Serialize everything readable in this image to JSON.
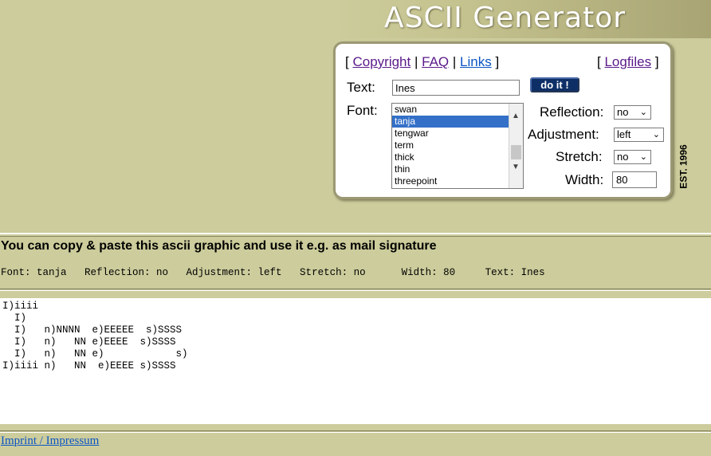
{
  "banner": {
    "title": "ASCII Generator",
    "est": "EST. 1996"
  },
  "links": {
    "copyright": "Copyright",
    "faq": "FAQ",
    "links": "Links",
    "logfiles": "Logfiles",
    "lbr": "[",
    "rbr": "]",
    "sep": "|"
  },
  "form": {
    "text_label": "Text:",
    "text_value": "Ines",
    "button": "do it !",
    "font_label": "Font:",
    "fonts": [
      "swan",
      "tanja",
      "tengwar",
      "term",
      "thick",
      "thin",
      "threepoint"
    ],
    "selected_font": "tanja",
    "reflection_label": "Reflection:",
    "reflection_value": "no",
    "adjustment_label": "Adjustment:",
    "adjustment_value": "left",
    "stretch_label": "Stretch:",
    "stretch_value": "no",
    "width_label": "Width:",
    "width_value": "80"
  },
  "result": {
    "hint": "You can copy & paste this ascii graphic and use it e.g. as mail signature",
    "params": "Font: tanja   Reflection: no   Adjustment: left   Stretch: no      Width: 80     Text: Ines",
    "ascii": "I)iiii\n  I)\n  I)   n)NNNN  e)EEEEE  s)SSSS\n  I)   n)   NN e)EEEE  s)SSSS\n  I)   n)   NN e)            s)\nI)iiii n)   NN  e)EEEE s)SSSS"
  },
  "footer": {
    "imprint": "Imprint / Impressum"
  },
  "colors": {
    "background": "#cccc9c",
    "button": "#0e2f66",
    "selection": "#3470c8",
    "visited_link": "#5a1a8a",
    "link": "#0b55c4"
  }
}
